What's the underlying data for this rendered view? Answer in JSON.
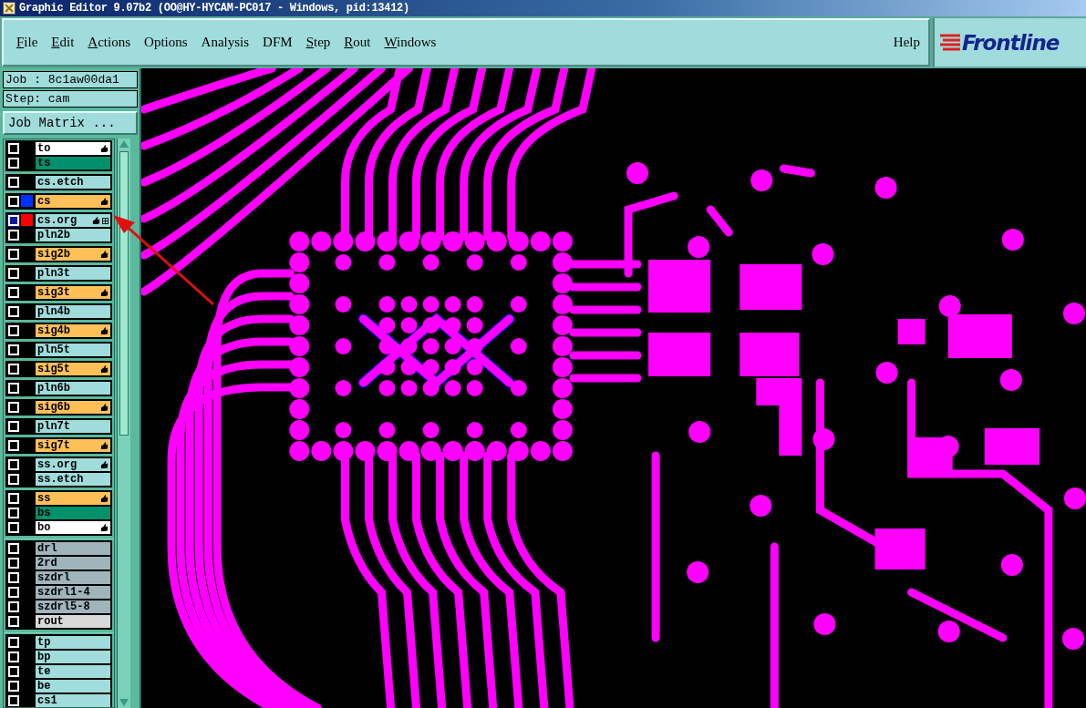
{
  "window": {
    "title": "Graphic Editor 9.07b2 (OO@HY-HYCAM-PC017 - Windows, pid:13412)"
  },
  "menu": [
    {
      "label": "File",
      "underlined": true
    },
    {
      "label": "Edit",
      "underlined": true
    },
    {
      "label": "Actions",
      "underlined": true
    },
    {
      "label": "Options",
      "underlined": false
    },
    {
      "label": "Analysis",
      "underlined": false
    },
    {
      "label": "DFM",
      "underlined": false
    },
    {
      "label": "Step",
      "underlined": true
    },
    {
      "label": "Rout",
      "underlined": true
    },
    {
      "label": "Windows",
      "underlined": true
    }
  ],
  "help": "Help",
  "logo": "Frontline",
  "job": "Job : 8c1aw00da1",
  "step": "Step: cam",
  "job_matrix_button": "Job Matrix ...",
  "sections": [
    {
      "groups": [
        {
          "layers": [
            {
              "name": "to",
              "color": "#ffffff",
              "marked": true,
              "selected": false
            },
            {
              "name": "ts",
              "color": "#00906c",
              "marked": false,
              "selected": false
            }
          ]
        },
        {
          "layers": [
            {
              "name": "cs.etch",
              "color": "#a0dcdc",
              "marked": false,
              "selected": false
            }
          ]
        },
        {
          "layers": [
            {
              "name": "cs",
              "color": "#ffc058",
              "marked": true,
              "selected": false,
              "swatch": {
                "color": "#0030ff"
              }
            }
          ]
        },
        {
          "layers": [
            {
              "name": "cs.org",
              "color": "#a0dcdc",
              "marked": true,
              "selected": true,
              "swatch": {
                "color": "#ff0000"
              },
              "grid": true
            },
            {
              "name": "pln2b",
              "color": "#a0dcdc",
              "marked": false,
              "selected": false
            }
          ]
        },
        {
          "layers": [
            {
              "name": "sig2b",
              "color": "#ffc058",
              "marked": true,
              "selected": false
            }
          ]
        },
        {
          "layers": [
            {
              "name": "pln3t",
              "color": "#a0dcdc",
              "marked": false,
              "selected": false
            }
          ]
        },
        {
          "layers": [
            {
              "name": "sig3t",
              "color": "#ffc058",
              "marked": true,
              "selected": false
            }
          ]
        },
        {
          "layers": [
            {
              "name": "pln4b",
              "color": "#a0dcdc",
              "marked": false,
              "selected": false
            }
          ]
        },
        {
          "layers": [
            {
              "name": "sig4b",
              "color": "#ffc058",
              "marked": true,
              "selected": false
            }
          ]
        },
        {
          "layers": [
            {
              "name": "pln5t",
              "color": "#a0dcdc",
              "marked": false,
              "selected": false
            }
          ]
        },
        {
          "layers": [
            {
              "name": "sig5t",
              "color": "#ffc058",
              "marked": true,
              "selected": false
            }
          ]
        },
        {
          "layers": [
            {
              "name": "pln6b",
              "color": "#a0dcdc",
              "marked": false,
              "selected": false
            }
          ]
        },
        {
          "layers": [
            {
              "name": "sig6b",
              "color": "#ffc058",
              "marked": true,
              "selected": false
            }
          ]
        },
        {
          "layers": [
            {
              "name": "pln7t",
              "color": "#a0dcdc",
              "marked": false,
              "selected": false
            }
          ]
        },
        {
          "layers": [
            {
              "name": "sig7t",
              "color": "#ffc058",
              "marked": true,
              "selected": false
            }
          ]
        },
        {
          "layers": [
            {
              "name": "ss.org",
              "color": "#a0dcdc",
              "marked": true,
              "selected": false
            },
            {
              "name": "ss.etch",
              "color": "#a0dcdc",
              "marked": false,
              "selected": false
            }
          ]
        },
        {
          "layers": [
            {
              "name": "ss",
              "color": "#ffc058",
              "marked": true,
              "selected": false
            },
            {
              "name": "bs",
              "color": "#00906c",
              "marked": false,
              "selected": false
            },
            {
              "name": "bo",
              "color": "#ffffff",
              "marked": true,
              "selected": false
            }
          ]
        }
      ]
    },
    {
      "groups": [
        {
          "layers": [
            {
              "name": "drl",
              "color": "#a0b4bc",
              "marked": false,
              "selected": false
            },
            {
              "name": "2rd",
              "color": "#a0b4bc",
              "marked": false,
              "selected": false
            },
            {
              "name": "szdrl",
              "color": "#a0b4bc",
              "marked": false,
              "selected": false
            },
            {
              "name": "szdrl1-4",
              "color": "#a0b4bc",
              "marked": false,
              "selected": false
            },
            {
              "name": "szdrl5-8",
              "color": "#a0b4bc",
              "marked": false,
              "selected": false
            },
            {
              "name": "rout",
              "color": "#d8d8d8",
              "marked": false,
              "selected": false
            }
          ]
        }
      ]
    },
    {
      "groups": [
        {
          "layers": [
            {
              "name": "tp",
              "color": "#a0dcdc",
              "marked": false,
              "selected": false
            },
            {
              "name": "bp",
              "color": "#a0dcdc",
              "marked": false,
              "selected": false
            },
            {
              "name": "te",
              "color": "#a0dcdc",
              "marked": false,
              "selected": false
            },
            {
              "name": "be",
              "color": "#a0dcdc",
              "marked": false,
              "selected": false
            },
            {
              "name": "cs1",
              "color": "#a0dcdc",
              "marked": false,
              "selected": false
            }
          ]
        }
      ]
    }
  ]
}
